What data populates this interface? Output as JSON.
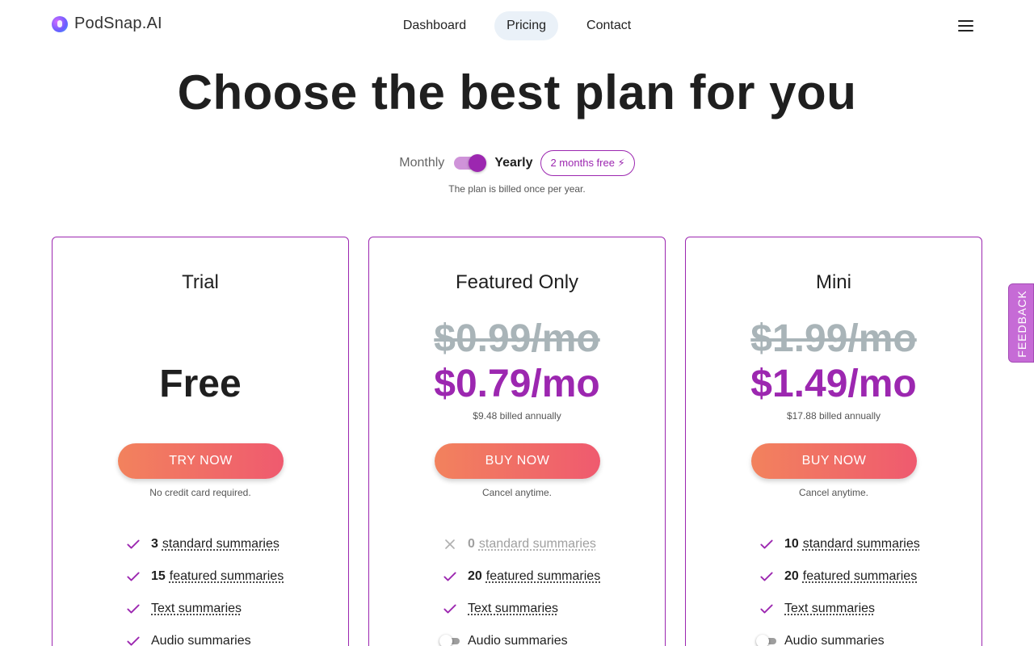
{
  "brand": {
    "name": "PodSnap.AI"
  },
  "nav": {
    "links": [
      {
        "label": "Dashboard",
        "active": false
      },
      {
        "label": "Pricing",
        "active": true
      },
      {
        "label": "Contact",
        "active": false
      }
    ]
  },
  "hero": {
    "title": "Choose the best plan for you"
  },
  "billing": {
    "monthly_label": "Monthly",
    "yearly_label": "Yearly",
    "yearly_selected": true,
    "badge": "2 months free ⚡",
    "note": "The plan is billed once per year."
  },
  "plans": [
    {
      "name": "Trial",
      "old_price": "",
      "price": "Free",
      "annual": "",
      "cta": "TRY NOW",
      "cta_note": "No credit card required.",
      "features": [
        {
          "num": "3",
          "label": "standard summaries",
          "state": "check"
        },
        {
          "num": "15",
          "label": "featured summaries",
          "state": "check"
        },
        {
          "num": "",
          "label": "Text summaries",
          "state": "check"
        },
        {
          "num": "",
          "label": "Audio summaries",
          "state": "check"
        }
      ]
    },
    {
      "name": "Featured Only",
      "old_price": "$0.99/mo",
      "price": "$0.79/mo",
      "annual": "$9.48 billed annually",
      "cta": "BUY NOW",
      "cta_note": "Cancel anytime.",
      "features": [
        {
          "num": "0",
          "label": "standard summaries",
          "state": "cross"
        },
        {
          "num": "20",
          "label": "featured summaries",
          "state": "check"
        },
        {
          "num": "",
          "label": "Text summaries",
          "state": "check"
        },
        {
          "num": "",
          "label": "Audio summaries",
          "state": "toggle"
        }
      ]
    },
    {
      "name": "Mini",
      "old_price": "$1.99/mo",
      "price": "$1.49/mo",
      "annual": "$17.88 billed annually",
      "cta": "BUY NOW",
      "cta_note": "Cancel anytime.",
      "features": [
        {
          "num": "10",
          "label": "standard summaries",
          "state": "check"
        },
        {
          "num": "20",
          "label": "featured summaries",
          "state": "check"
        },
        {
          "num": "",
          "label": "Text summaries",
          "state": "check"
        },
        {
          "num": "",
          "label": "Audio summaries",
          "state": "toggle"
        }
      ]
    }
  ],
  "feedback": {
    "label": "FEEDBACK"
  },
  "colors": {
    "accent": "#9c27b0",
    "cta_start": "#f2825d",
    "cta_end": "#ef5a6f",
    "strike": "#a9b4b8"
  }
}
